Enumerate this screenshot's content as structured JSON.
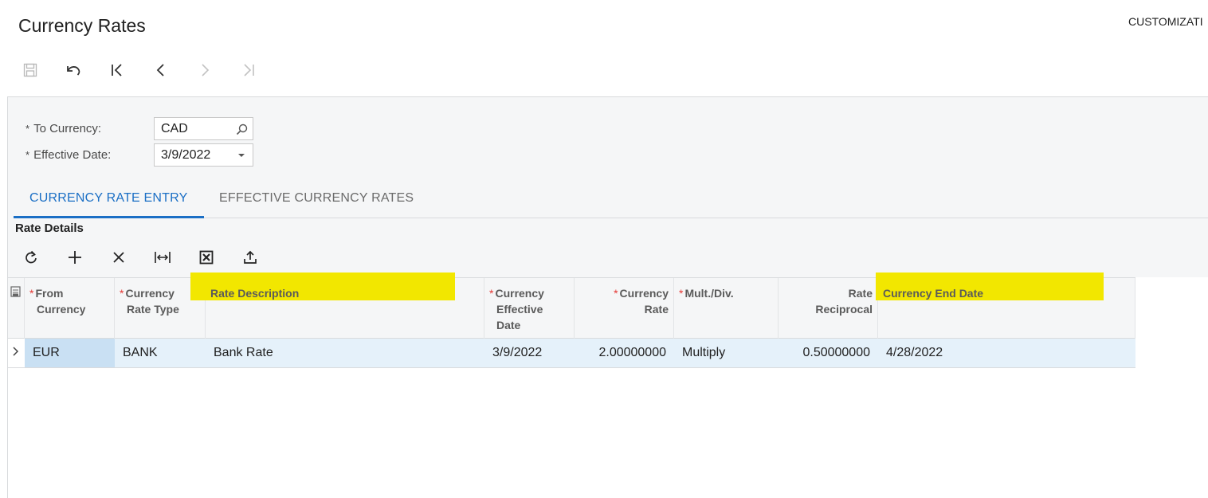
{
  "page": {
    "title": "Currency Rates",
    "customization_label": "CUSTOMIZATI"
  },
  "toolbar": {
    "buttons": [
      {
        "name": "save",
        "icon": "save-icon"
      },
      {
        "name": "undo",
        "icon": "undo-icon"
      },
      {
        "name": "first",
        "icon": "first-record-icon"
      },
      {
        "name": "previous",
        "icon": "chevron-left-icon"
      },
      {
        "name": "next",
        "icon": "chevron-right-icon"
      },
      {
        "name": "last",
        "icon": "last-record-icon"
      }
    ]
  },
  "form": {
    "to_currency": {
      "label": "To Currency:",
      "value": "CAD",
      "required_mark": "*"
    },
    "effective_date": {
      "label": "Effective Date:",
      "value": "3/9/2022",
      "required_mark": "*"
    }
  },
  "tabs": [
    {
      "label": "CURRENCY RATE ENTRY",
      "active": true
    },
    {
      "label": "EFFECTIVE CURRENCY RATES",
      "active": false
    }
  ],
  "section": {
    "title": "Rate Details"
  },
  "grid_toolbar": {
    "buttons": [
      "refresh-icon",
      "add-icon",
      "delete-icon",
      "fit-columns-icon",
      "excel-export-icon",
      "upload-icon"
    ]
  },
  "grid": {
    "columns": {
      "from_currency": {
        "line1": "From",
        "line2": "Currency",
        "required": "*"
      },
      "rate_type": {
        "line1": "Currency",
        "line2": "Rate Type",
        "required": "*"
      },
      "rate_description": {
        "line1": "Rate Description"
      },
      "effective_date": {
        "line1": "Currency",
        "line2": "Effective",
        "line3": "Date",
        "required": "*"
      },
      "currency_rate": {
        "line1": "Currency",
        "line2": "Rate",
        "required": "*"
      },
      "mult_div": {
        "line1": "Mult./Div.",
        "required": "*"
      },
      "rate_reciprocal": {
        "line1": "Rate",
        "line2": "Reciprocal"
      },
      "end_date": {
        "line1": "Currency End Date"
      }
    },
    "rows": [
      {
        "from_currency": "EUR",
        "rate_type": "BANK",
        "rate_description": "Bank Rate",
        "effective_date": "3/9/2022",
        "currency_rate": "2.00000000",
        "mult_div": "Multiply",
        "rate_reciprocal": "0.50000000",
        "end_date": "4/28/2022"
      }
    ]
  },
  "colors": {
    "accent": "#1b6fc5",
    "highlight": "#f2e700",
    "required": "#e53935",
    "row_selected": "#e5f1fa"
  }
}
